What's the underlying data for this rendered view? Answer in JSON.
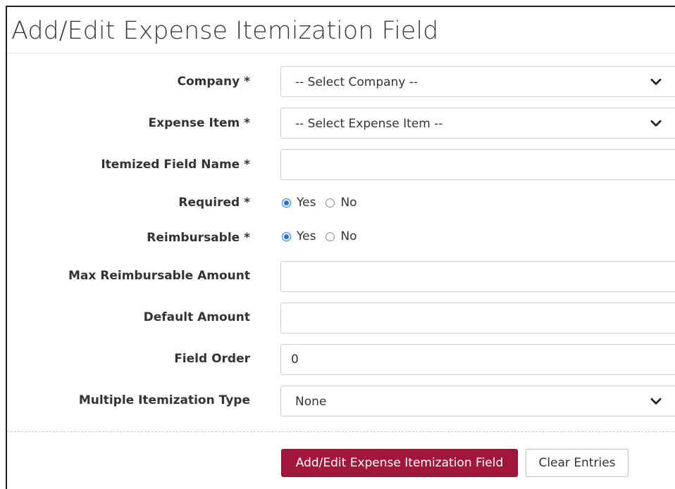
{
  "page": {
    "title": "Add/Edit Expense Itemization Field"
  },
  "form": {
    "company": {
      "label": "Company *",
      "selected": "-- Select Company --"
    },
    "expense_item": {
      "label": "Expense Item *",
      "selected": "-- Select Expense Item --"
    },
    "itemized_field_name": {
      "label": "Itemized Field Name *",
      "value": ""
    },
    "required": {
      "label": "Required *",
      "options": [
        "Yes",
        "No"
      ],
      "selected": "Yes"
    },
    "reimbursable": {
      "label": "Reimbursable *",
      "options": [
        "Yes",
        "No"
      ],
      "selected": "Yes"
    },
    "max_reimbursable_amount": {
      "label": "Max Reimbursable Amount",
      "value": ""
    },
    "default_amount": {
      "label": "Default Amount",
      "value": ""
    },
    "field_order": {
      "label": "Field Order",
      "value": "0"
    },
    "multiple_itemization_type": {
      "label": "Multiple Itemization Type",
      "selected": "None"
    }
  },
  "actions": {
    "submit_label": "Add/Edit Expense Itemization Field",
    "clear_label": "Clear Entries"
  },
  "colors": {
    "primary_button": "#a3163c",
    "radio_accent": "#1a73e8"
  },
  "icons": {
    "select_arrow": "chevron-down-icon",
    "radio": "radio-button-icon"
  }
}
